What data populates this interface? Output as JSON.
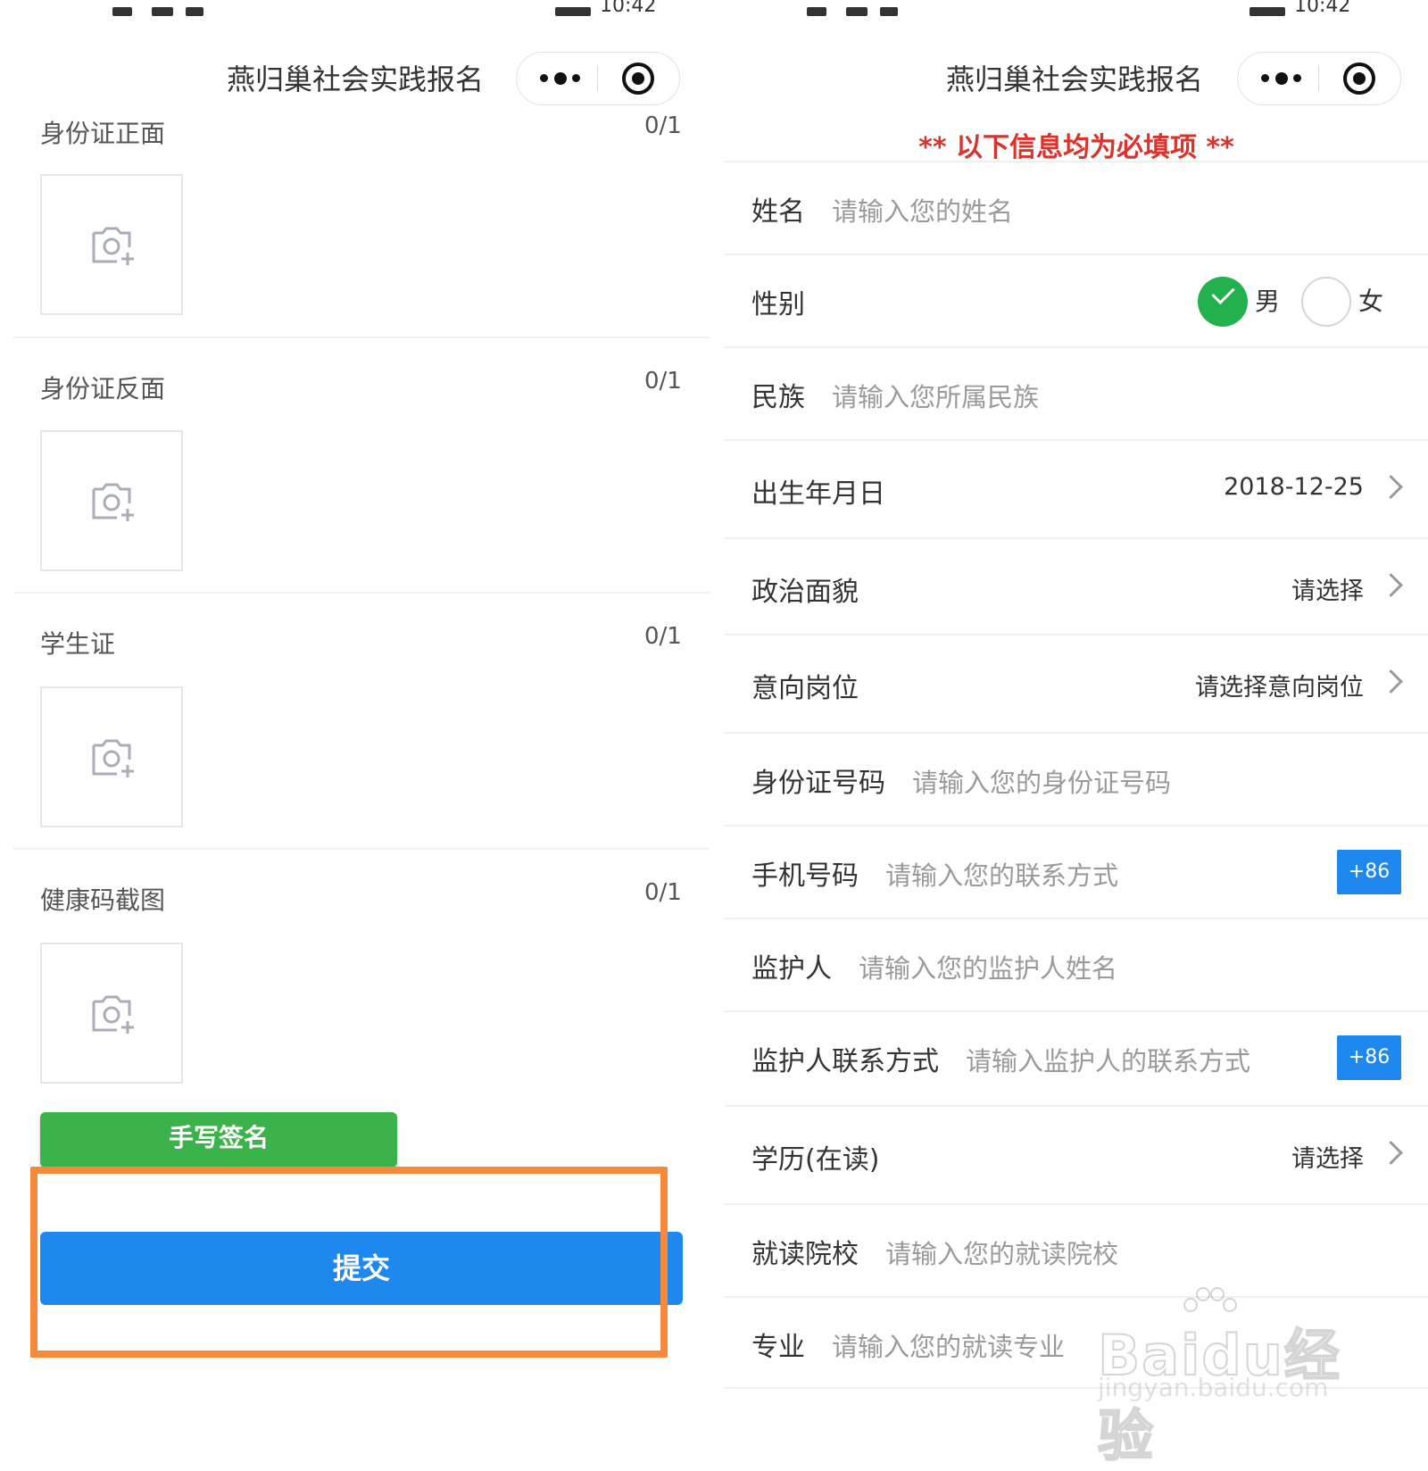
{
  "status_bar": {
    "time": "10:42"
  },
  "left_screen": {
    "nav_title": "燕归巢社会实践报名",
    "uploads": [
      {
        "label": "身份证正面",
        "count": "0/1"
      },
      {
        "label": "身份证反面",
        "count": "0/1"
      },
      {
        "label": "学生证",
        "count": "0/1"
      },
      {
        "label": "健康码截图",
        "count": "0/1"
      }
    ],
    "sign_label": "手写签名",
    "submit_label": "提交",
    "highlight_color": "#f68a3a"
  },
  "right_screen": {
    "nav_title": "燕归巢社会实践报名",
    "notice": "** 以下信息均为必填项 **",
    "name": {
      "label": "姓名",
      "placeholder": "请输入您的姓名"
    },
    "gender": {
      "label": "性别",
      "options": [
        "男",
        "女"
      ],
      "selected": "男"
    },
    "ethnicity": {
      "label": "民族",
      "placeholder": "请输入您所属民族"
    },
    "birthdate": {
      "label": "出生年月日",
      "value": "2018-12-25"
    },
    "political": {
      "label": "政治面貌",
      "value": "请选择"
    },
    "position": {
      "label": "意向岗位",
      "value": "请选择意向岗位"
    },
    "id_number": {
      "label": "身份证号码",
      "placeholder": "请输入您的身份证号码"
    },
    "phone": {
      "label": "手机号码",
      "placeholder": "请输入您的联系方式",
      "prefix": "+86"
    },
    "guardian": {
      "label": "监护人",
      "placeholder": "请输入您的监护人姓名"
    },
    "guardian_phone": {
      "label": "监护人联系方式",
      "placeholder": "请输入监护人的联系方式",
      "prefix": "+86"
    },
    "education": {
      "label": "学历(在读)",
      "value": "请选择"
    },
    "school": {
      "label": "就读院校",
      "placeholder": "请输入您的就读院校"
    },
    "major": {
      "label": "专业",
      "placeholder": "请输入您的就读专业"
    }
  },
  "watermark": {
    "brand": "Baidu经验",
    "url": "jingyan.baidu.com"
  },
  "colors": {
    "primary_blue": "#1e88ee",
    "sign_green": "#3cb34a",
    "check_green": "#23b14d",
    "notice_red": "#d9332c"
  }
}
